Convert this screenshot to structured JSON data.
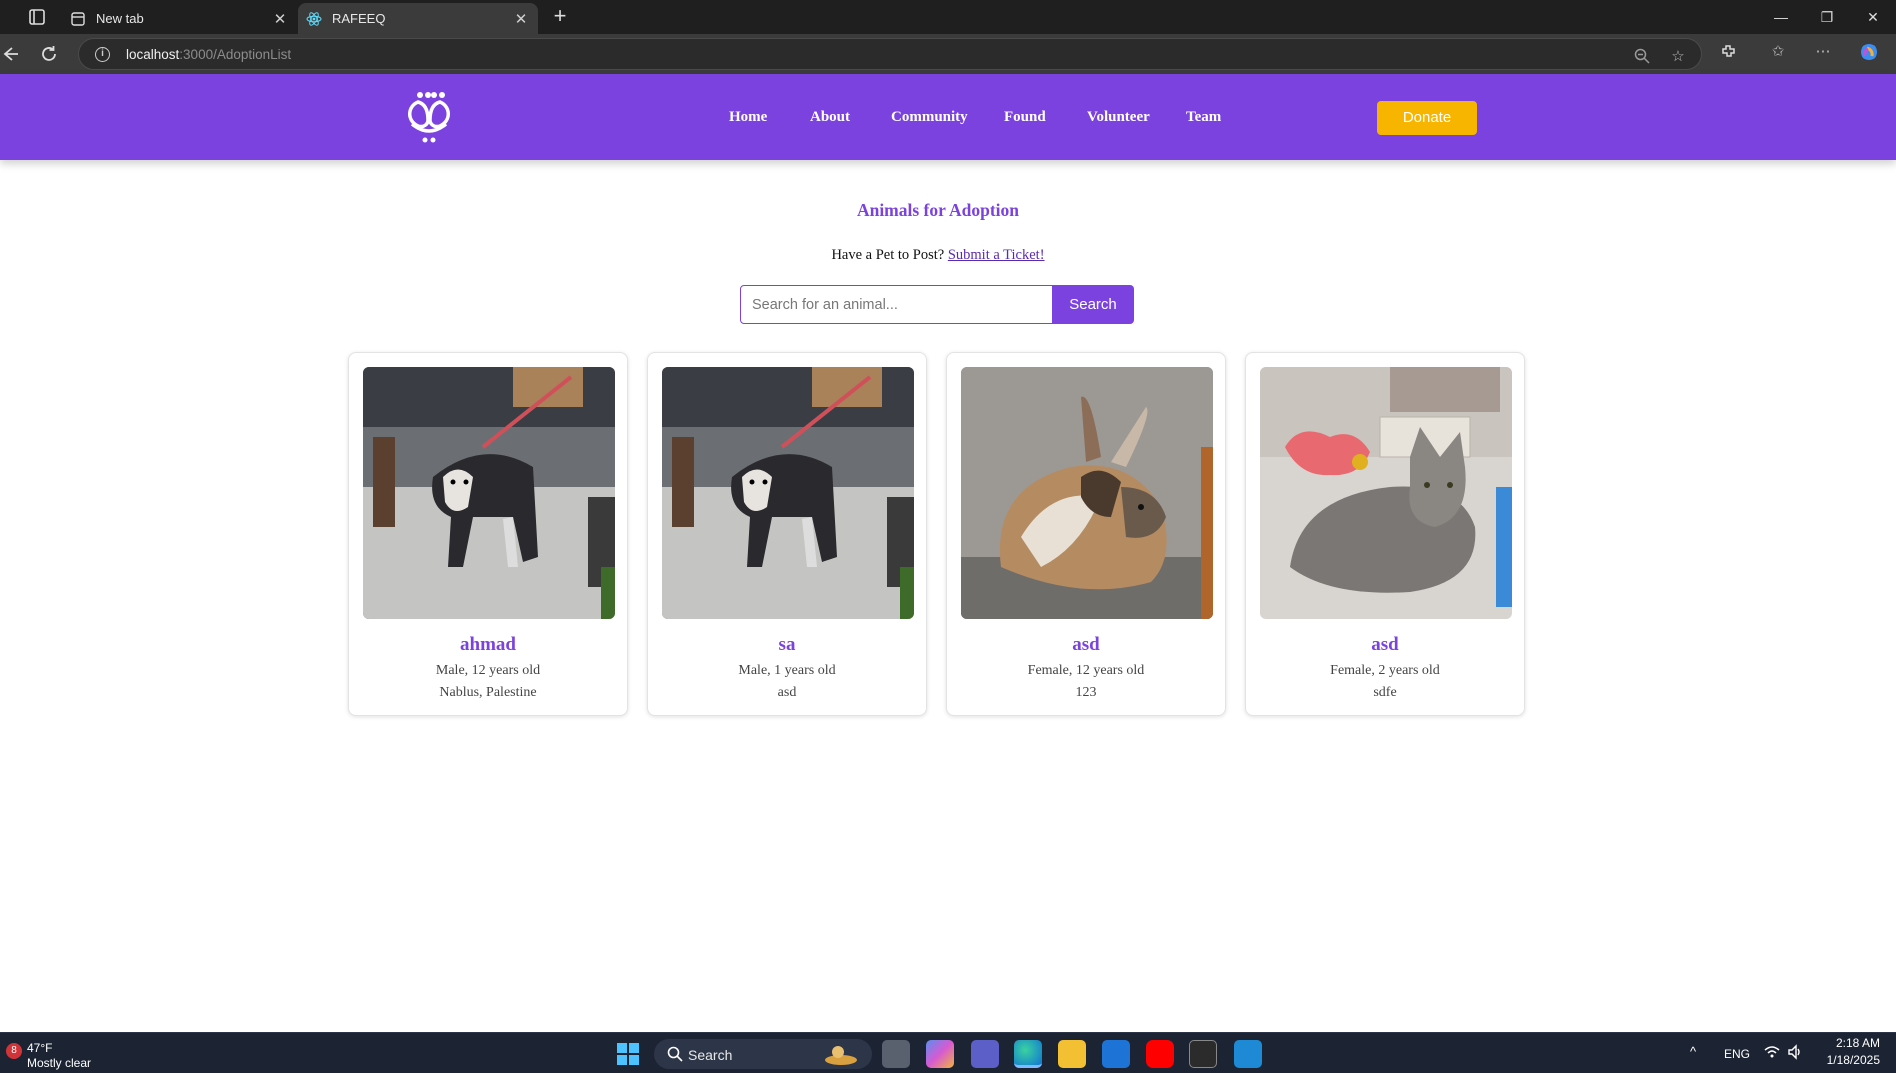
{
  "browser": {
    "tabs": [
      {
        "title": "New tab",
        "icon": "new-tab-page-icon",
        "active": false
      },
      {
        "title": "RAFEEQ",
        "icon": "react-icon",
        "active": true
      }
    ],
    "url": {
      "host": "localhost",
      "rest": ":3000/AdoptionList"
    }
  },
  "site": {
    "logo": "rafeeq-paw-logo",
    "nav": [
      "Home",
      "About",
      "Community",
      "Found",
      "Volunteer",
      "Team"
    ],
    "donate_label": "Donate",
    "colors": {
      "primary": "#7b42e0",
      "donate": "#f7b500"
    }
  },
  "main": {
    "title": "Animals for Adoption",
    "post_prompt": "Have a Pet to Post? ",
    "post_link": "Submit a Ticket!",
    "search_placeholder": "Search for an animal...",
    "search_button": "Search",
    "animals": [
      {
        "name": "ahmad",
        "info": "Male, 12 years old",
        "location": "Nablus, Palestine",
        "photo": "husky-dog-photo"
      },
      {
        "name": "sa",
        "info": "Male, 1 years old",
        "location": "asd",
        "photo": "husky-dog-photo"
      },
      {
        "name": "asd",
        "info": "Female, 12 years old",
        "location": "123",
        "photo": "calico-rabbit-photo"
      },
      {
        "name": "asd",
        "info": "Female, 2 years old",
        "location": "sdfe",
        "photo": "grey-cat-photo"
      }
    ]
  },
  "taskbar": {
    "weather_badge": "8",
    "weather_temp": "47°F",
    "weather_desc": "Mostly clear",
    "search_label": "Search",
    "language": "ENG",
    "time": "2:18 AM",
    "date": "1/18/2025"
  }
}
